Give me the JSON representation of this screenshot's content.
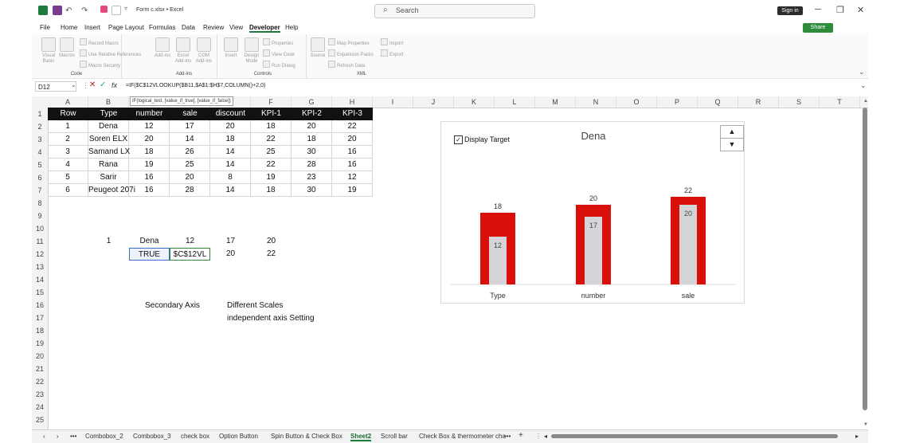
{
  "titlebar": {
    "doc_title": "Form c.xlsx",
    "app": "Excel",
    "separator": "•",
    "search": "Search",
    "signin": "Sign in"
  },
  "menu": [
    "File",
    "Home",
    "Insert",
    "Page Layout",
    "Formulas",
    "Data",
    "Review",
    "View",
    "Developer",
    "Help"
  ],
  "share": "Share",
  "ribbon": {
    "code": {
      "label": "Code",
      "vb": "Visual Basic",
      "macros": "Macros",
      "record": "Record Macro",
      "relative": "Use Relative References",
      "security": "Macro Security"
    },
    "addins": {
      "label": "Add-ins",
      "a1": "Add-ins",
      "a2": "Excel Add-ins",
      "a3": "COM Add-ins"
    },
    "controls": {
      "label": "Controls",
      "insert": "Insert",
      "design": "Design Mode",
      "props": "Properties",
      "viewcode": "View Code",
      "rundialog": "Run Dialog"
    },
    "xml": {
      "label": "XML",
      "source": "Source",
      "mapprops": "Map Properties",
      "expansion": "Expansion Packs",
      "refresh": "Refresh Data",
      "import": "Import",
      "export": "Export"
    }
  },
  "namebox": "D12",
  "formula": "=IF($C$12VLOOKUP($B11,$A$1:$H$7,COLUMN()+2,0)",
  "tooltip": "IF(logical_test, [value_if_true], [value_if_false])",
  "columns": [
    "A",
    "B",
    "C",
    "D",
    "E",
    "F",
    "G",
    "H",
    "I",
    "J",
    "K",
    "L",
    "M",
    "N",
    "O",
    "P",
    "Q",
    "R",
    "S",
    "T"
  ],
  "rows": [
    "1",
    "2",
    "3",
    "4",
    "5",
    "6",
    "7",
    "8",
    "9",
    "10",
    "11",
    "12",
    "13",
    "14",
    "15",
    "16",
    "17",
    "18",
    "19",
    "20",
    "21",
    "22",
    "23",
    "24",
    "25"
  ],
  "table": {
    "headers": [
      "Row",
      "Type",
      "number",
      "sale",
      "discount",
      "KPI-1",
      "KPI-2",
      "KPI-3"
    ],
    "rows": [
      [
        "1",
        "Dena",
        "12",
        "17",
        "20",
        "18",
        "20",
        "22"
      ],
      [
        "2",
        "Soren ELX",
        "20",
        "14",
        "18",
        "22",
        "18",
        "20"
      ],
      [
        "3",
        "Samand LX",
        "18",
        "26",
        "14",
        "25",
        "30",
        "16"
      ],
      [
        "4",
        "Rana",
        "19",
        "25",
        "14",
        "22",
        "28",
        "16"
      ],
      [
        "5",
        "Sarir",
        "16",
        "20",
        "8",
        "19",
        "23",
        "12"
      ],
      [
        "6",
        "Peugeot 207i",
        "16",
        "28",
        "14",
        "18",
        "30",
        "19"
      ]
    ]
  },
  "row11": [
    "1",
    "Dena",
    "12",
    "17",
    "20"
  ],
  "row12": [
    "TRUE",
    "$C$12VL",
    "20",
    "22"
  ],
  "notes": {
    "secondary": "Secondary Axis",
    "different": "Different Scales",
    "independent": "independent axis Setting"
  },
  "chart": {
    "checkbox_label": "Display Target",
    "checked": true,
    "title": "Dena"
  },
  "chart_data": {
    "type": "bar",
    "categories": [
      "Type",
      "number",
      "sale"
    ],
    "series": [
      {
        "values": [
          18,
          20,
          22
        ]
      },
      {
        "values": [
          12,
          17,
          20
        ]
      }
    ],
    "colors": {
      "outer": "#d9100a",
      "inner": "#d6d4d8"
    }
  },
  "tabs": [
    "Combobox_2",
    "Combobox_3",
    "check box",
    "Option Button",
    "Spin Button & Check Box",
    "Sheet2",
    "Scroll bar",
    "Check Box & thermometer cha"
  ],
  "active_tab": "Sheet2"
}
